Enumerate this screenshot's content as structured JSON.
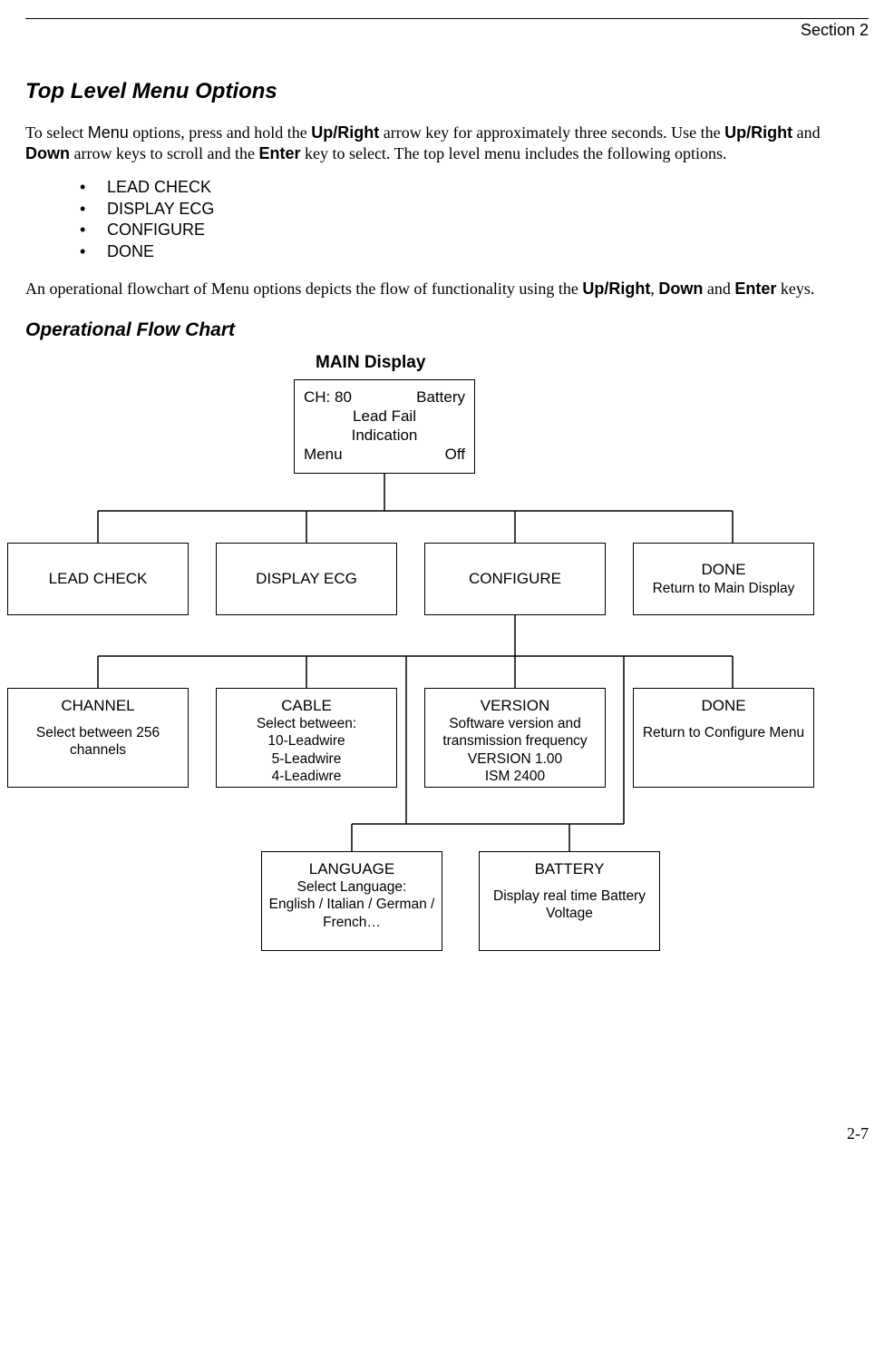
{
  "header": {
    "section": "Section 2"
  },
  "title": "Top Level Menu Options",
  "intro": {
    "prefix": "To select ",
    "word_menu": "Menu",
    "mid1": " options, press and hold the ",
    "word_upright": "Up/Right",
    "mid2": " arrow key for approximately three seconds. Use the ",
    "word_upright2": "Up/Right",
    "mid3": " and ",
    "word_down": "Down",
    "mid4": " arrow keys to scroll and the ",
    "word_enter": "Enter",
    "suffix": " key to select. The top level menu includes the following options."
  },
  "menu_items": [
    "LEAD CHECK",
    "DISPLAY ECG",
    "CONFIGURE",
    "DONE"
  ],
  "para2": {
    "prefix": "An operational flowchart of Menu options depicts the flow of functionality using the ",
    "w1": "Up/Right",
    "mid1": ", ",
    "w2": "Down",
    "mid2": " and ",
    "w3": "Enter",
    "suffix": " keys."
  },
  "subtitle": "Operational Flow Chart",
  "flow": {
    "main_label": "MAIN Display",
    "main_box": {
      "ch": "CH: 80",
      "batt": "Battery",
      "lead": "Lead Fail",
      "ind": "Indication",
      "menu": "Menu",
      "off": "Off"
    },
    "row1": [
      {
        "title": "LEAD CHECK",
        "sub": ""
      },
      {
        "title": "DISPLAY ECG",
        "sub": ""
      },
      {
        "title": "CONFIGURE",
        "sub": ""
      },
      {
        "title": "DONE",
        "sub": "Return to Main Display"
      }
    ],
    "row2": [
      {
        "title": "CHANNEL",
        "sub": "Select between 256 channels"
      },
      {
        "title": "CABLE",
        "sub": "Select between:\n10-Leadwire\n5-Leadwire\n4-Leadiwre"
      },
      {
        "title": "VERSION",
        "sub": "Software version and transmission frequency\nVERSION 1.00\nISM 2400"
      },
      {
        "title": "DONE",
        "sub": "Return to Configure Menu"
      }
    ],
    "row3": [
      {
        "title": "LANGUAGE",
        "sub": "Select Language:\nEnglish / Italian / German / French…"
      },
      {
        "title": "BATTERY",
        "sub": "Display real time Battery Voltage"
      }
    ]
  },
  "page_number": "2-7"
}
